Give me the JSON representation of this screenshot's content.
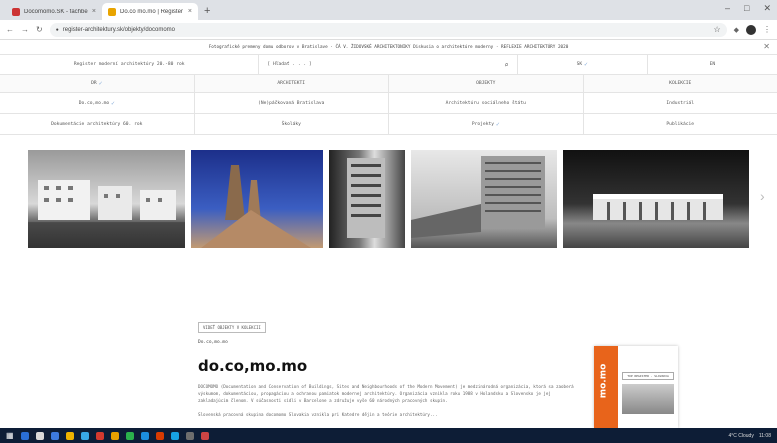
{
  "browser": {
    "tabs": [
      {
        "title": "Docomomo.SK - fachbereitung...",
        "color": "#c33"
      },
      {
        "title": "Do.co mo.mo | Register mode...",
        "color": "#e8a400"
      }
    ],
    "new_tab_glyph": "+",
    "window_controls": [
      "–",
      "□",
      "✕"
    ],
    "url": "register-architektury.sk/objekty/docomomo",
    "nav_glyphs": {
      "back": "←",
      "forward": "→",
      "reload": "↻",
      "lock": "🔒",
      "star": "☆",
      "menu": "⋮"
    }
  },
  "site": {
    "ticker_text": "Fotografické premeny domu odborov v Bratislave · ČÁ V. ŽIDOVSKÉ ARCHITEKTONIKY Diskusia o architektúre moderny · REFLEXIE ARCHITEKTÚRY 2020",
    "close_glyph": "✕",
    "search_row": {
      "register": "Register moderní architektúry 20.-80 rok",
      "search_placeholder": "[ Hľadať . . . ]",
      "search_icon": "⌕",
      "language": "SK",
      "language_check": "✓",
      "alt_language": "EN"
    },
    "nav": [
      {
        "label": "DR",
        "check": "✓"
      },
      {
        "label": "ARCHITEKTI",
        "check": ""
      },
      {
        "label": "OBJEKTY",
        "check": ""
      },
      {
        "label": "KOLEKCIE",
        "check": ""
      }
    ],
    "subnav_rows": [
      [
        {
          "label": "Do.co,mo.mo",
          "check": "✓"
        },
        {
          "label": "(Ne)páčkovaná Bratislava",
          "check": ""
        },
        {
          "label": "Architektúru sociálneho štátu",
          "check": ""
        },
        {
          "label": "Industriál",
          "check": ""
        }
      ],
      [
        {
          "label": "Dokumentácie architektúry 60. rok",
          "check": ""
        },
        {
          "label": "Školáky",
          "check": ""
        },
        {
          "label": "Projekty",
          "check": "✓"
        },
        {
          "label": "Publikácie",
          "check": ""
        }
      ]
    ],
    "gallery_next": "›",
    "tag": "VIDEŤ OBJEKTY V KOLEKCII",
    "breadcrumb": "Do.co,mo.mo",
    "title": "do.co,mo.mo",
    "description": "DOCOMOMO (Documentation and Conservation of Buildings, Sites and Neighbourhoods of the Modern Movement) je medzinárodná organizácia, ktorá sa zaoberá výskumom, dokumentáciou, propagáciou a ochranou pamiatok modernej architektúry. Organizácia vznikla roku 1988 v Holandsku a Slovensko je jej zakladajúcim členom. V súčasnosti sídli v Barcelone a združuje vyše 60 národných pracovných skupín.",
    "description2": "Slovenská pracovná skupina docomomo Slovakia vznikla pri Katedre dějin a teórie architektúry...",
    "book": {
      "spine": "mo.mo",
      "header": "TOP REGISTER · SLOVAKIA"
    }
  },
  "taskbar": {
    "apps": [
      "#2a6fd6",
      "#d9d9d9",
      "#3d7be0",
      "#f0b400",
      "#38a8e8",
      "#d43a2f",
      "#e8a000",
      "#2bb24c",
      "#1c8fe0",
      "#d83b01",
      "#17a2e4",
      "#6e6e6e",
      "#c44"
    ],
    "tray_text": "4°C Cloudy",
    "time": "11:08"
  },
  "colors": {
    "accent_check": "#7fa7d6",
    "taskbar_bg": "#0d1d36",
    "tab_bar": "#dee1e6"
  }
}
